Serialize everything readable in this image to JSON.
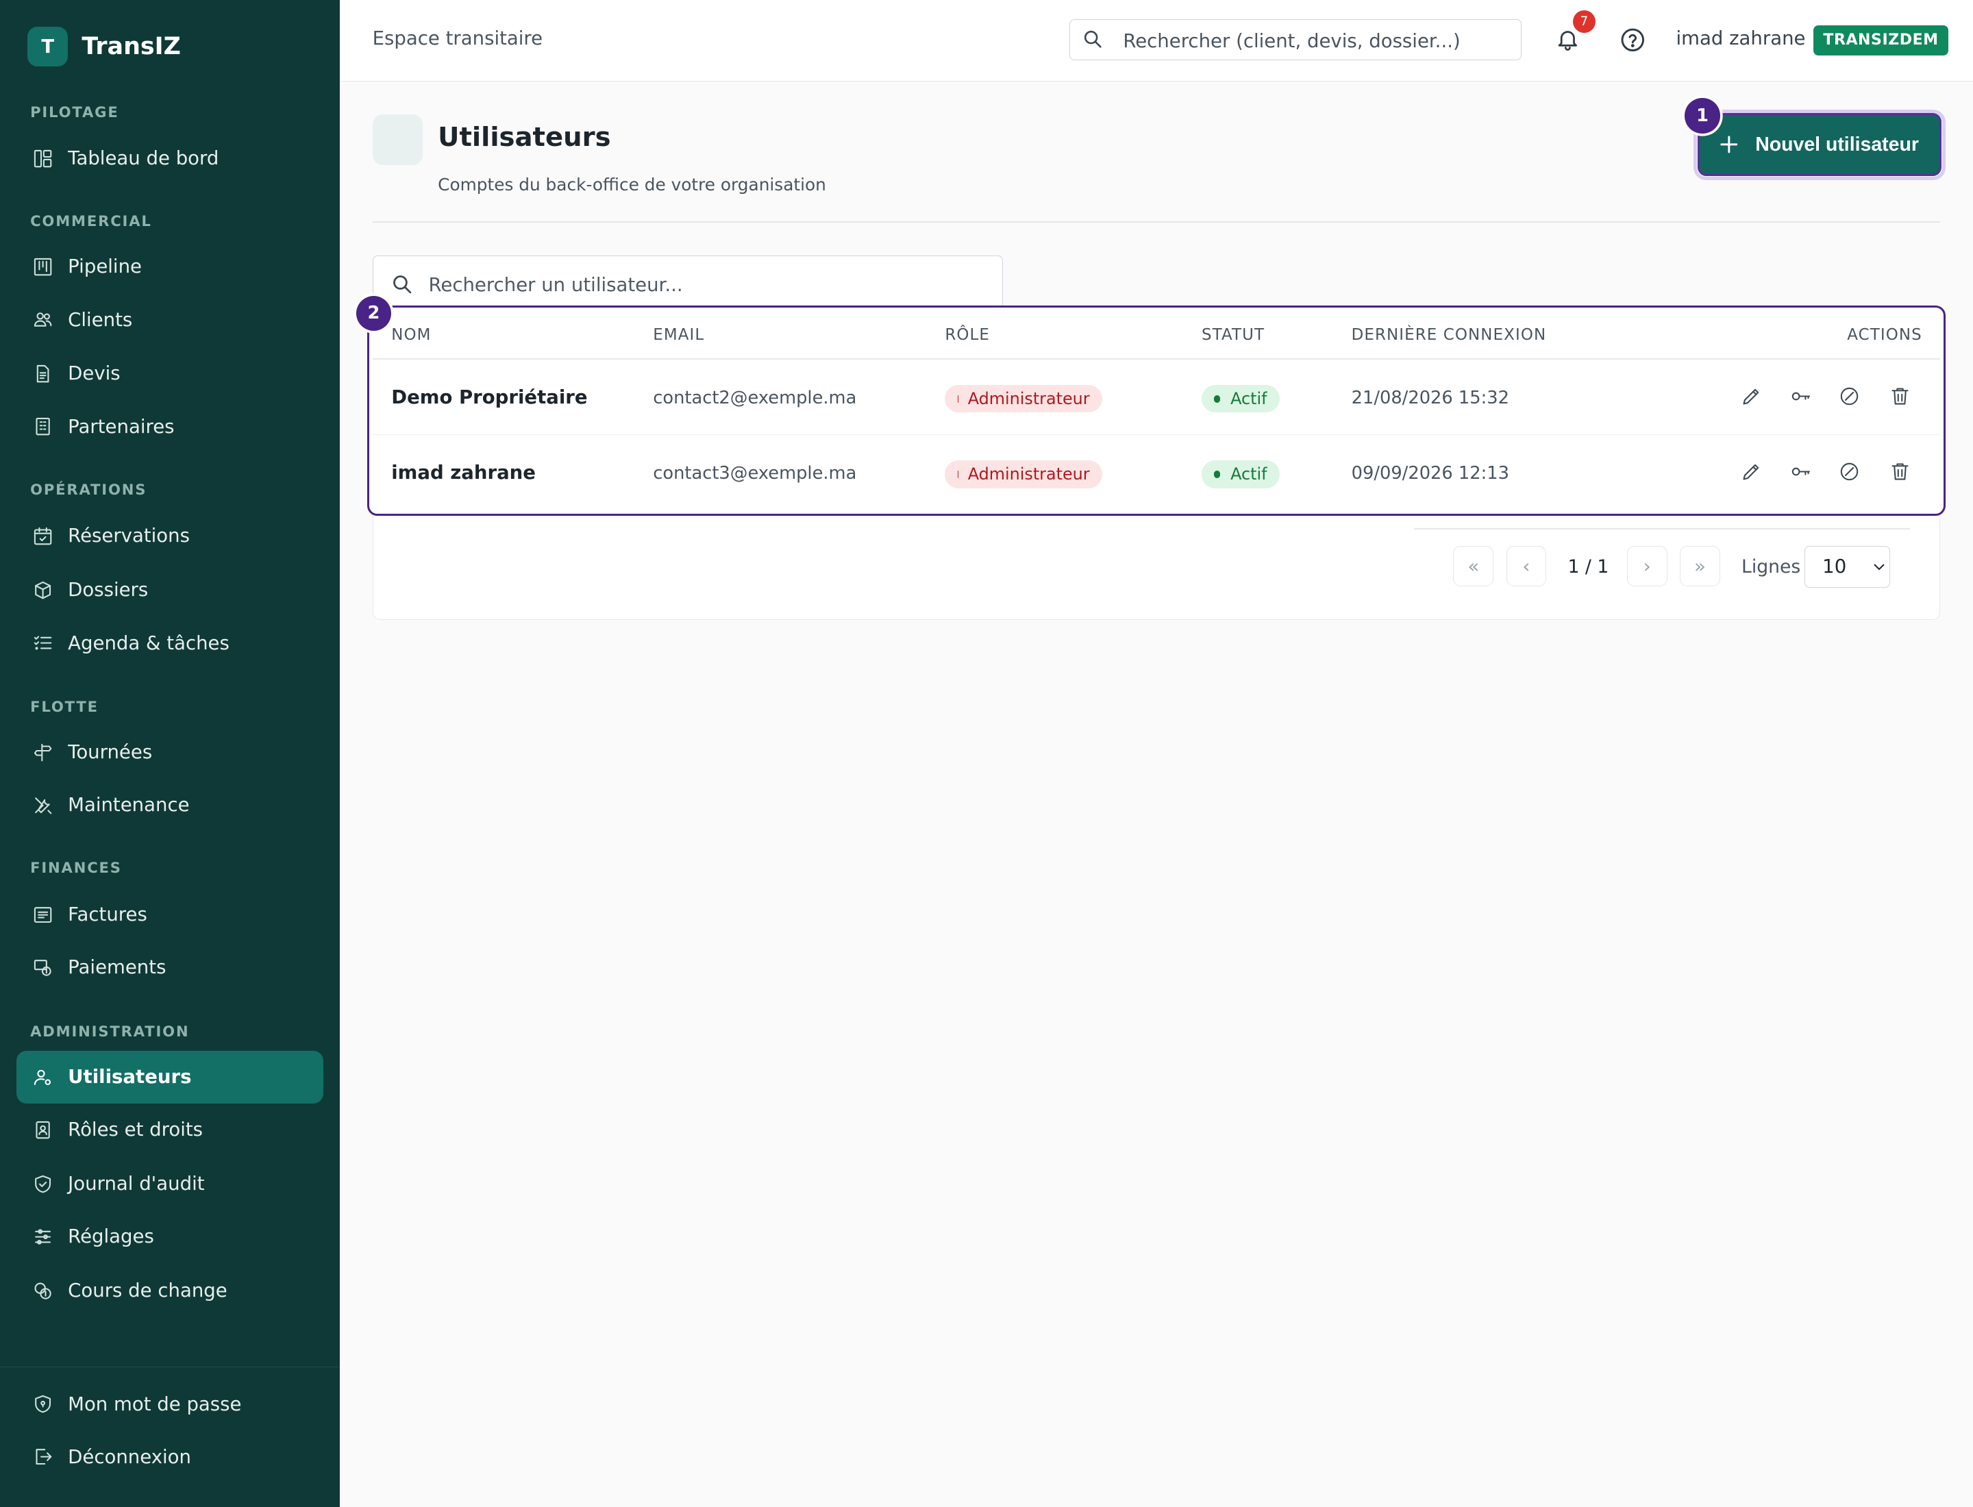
{
  "app": {
    "logo_letter": "T",
    "name": "TransIZ",
    "colors": {
      "sidebar_bg": "#0f3936",
      "accent": "#127066",
      "highlight": "#4a2386"
    }
  },
  "sidebar": {
    "groups": [
      {
        "title": "PILOTAGE",
        "items": [
          {
            "label": "Tableau de bord",
            "icon": "dashboard-icon"
          }
        ]
      },
      {
        "title": "COMMERCIAL",
        "items": [
          {
            "label": "Pipeline",
            "icon": "kanban-icon"
          },
          {
            "label": "Clients",
            "icon": "users-icon"
          },
          {
            "label": "Devis",
            "icon": "document-icon"
          },
          {
            "label": "Partenaires",
            "icon": "building-icon"
          }
        ]
      },
      {
        "title": "OPÉRATIONS",
        "items": [
          {
            "label": "Réservations",
            "icon": "calendar-check-icon"
          },
          {
            "label": "Dossiers",
            "icon": "box-icon"
          },
          {
            "label": "Agenda & tâches",
            "icon": "list-check-icon"
          }
        ]
      },
      {
        "title": "FLOTTE",
        "items": [
          {
            "label": "Tournées",
            "icon": "signpost-icon"
          },
          {
            "label": "Maintenance",
            "icon": "tools-icon"
          }
        ]
      },
      {
        "title": "FINANCES",
        "items": [
          {
            "label": "Factures",
            "icon": "receipt-icon"
          },
          {
            "label": "Paiements",
            "icon": "payment-icon"
          }
        ]
      },
      {
        "title": "ADMINISTRATION",
        "items": [
          {
            "label": "Utilisateurs",
            "icon": "user-cog-icon",
            "active": true
          },
          {
            "label": "Rôles et droits",
            "icon": "id-badge-icon"
          },
          {
            "label": "Journal d'audit",
            "icon": "shield-check-icon"
          },
          {
            "label": "Réglages",
            "icon": "sliders-icon"
          },
          {
            "label": "Cours de change",
            "icon": "coins-icon"
          }
        ]
      }
    ],
    "footer": [
      {
        "label": "Mon mot de passe",
        "icon": "shield-lock-icon"
      },
      {
        "label": "Déconnexion",
        "icon": "logout-icon"
      }
    ]
  },
  "topbar": {
    "breadcrumb": "Espace transitaire",
    "search_placeholder": "Rechercher (client, devis, dossier...)",
    "notification_count": "7",
    "user_name": "imad zahrane",
    "tenant_badge": "TRANSIZDEM"
  },
  "page": {
    "title": "Utilisateurs",
    "subtitle": "Comptes du back-office de votre organisation",
    "new_button_label": "Nouvel utilisateur",
    "search_placeholder": "Rechercher un utilisateur...",
    "callouts": [
      "1",
      "2"
    ]
  },
  "table": {
    "columns": [
      "NOM",
      "EMAIL",
      "RÔLE",
      "STATUT",
      "DERNIÈRE CONNEXION",
      "ACTIONS"
    ],
    "rows": [
      {
        "name": "Demo Propriétaire",
        "email": "contact2@exemple.ma",
        "role": "Administrateur",
        "status": "Actif",
        "last_login": "21/08/2026 15:32"
      },
      {
        "name": "imad zahrane",
        "email": "contact3@exemple.ma",
        "role": "Administrateur",
        "status": "Actif",
        "last_login": "09/09/2026 12:13"
      }
    ],
    "actions": [
      "edit-icon",
      "key-icon",
      "disable-icon",
      "trash-icon"
    ]
  },
  "pagination": {
    "page_info": "1 / 1",
    "rows_label": "Lignes",
    "rows_value": "10",
    "rows_options": [
      "10"
    ]
  }
}
